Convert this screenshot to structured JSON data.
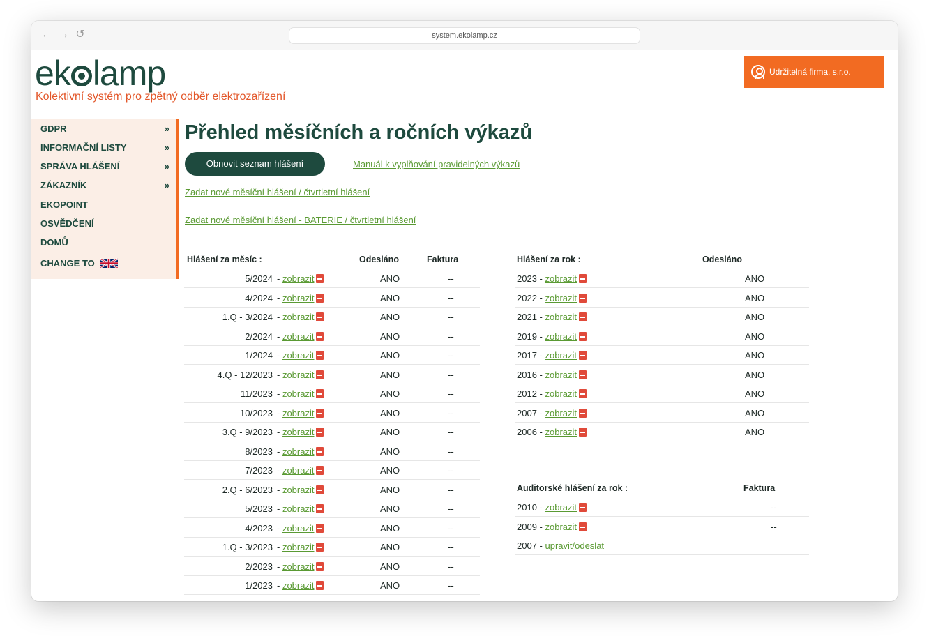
{
  "browser": {
    "url": "system.ekolamp.cz",
    "back_glyph": "←",
    "forward_glyph": "→",
    "reload_glyph": "↺"
  },
  "header": {
    "logo_pre": "ek",
    "logo_post": "lamp",
    "tagline": "Kolektivní systém pro zpětný odběr elektrozařízení",
    "user_label": "Udržitelná firma, s.r.o."
  },
  "sidebar": {
    "items": [
      {
        "label": "GDPR",
        "arrow": "»"
      },
      {
        "label": "INFORMAČNÍ LISTY",
        "arrow": "»"
      },
      {
        "label": "SPRÁVA HLÁŠENÍ",
        "arrow": "»"
      },
      {
        "label": "ZÁKAZNÍK",
        "arrow": "»"
      },
      {
        "label": "EKOPOINT",
        "arrow": ""
      },
      {
        "label": "OSVĚDČENÍ",
        "arrow": ""
      },
      {
        "label": "DOMŮ",
        "arrow": ""
      },
      {
        "label": "CHANGE TO",
        "arrow": ""
      }
    ]
  },
  "main": {
    "title": "Přehled měsíčních a ročních výkazů",
    "refresh_button": "Obnovit seznam hlášení",
    "manual_link": "Manuál k vyplňování pravidelných výkazů",
    "new_monthly_link": "Zadat nové měsíční hlášení / čtvrtletní hlášení",
    "new_battery_link": "Zadat nové měsíční hlášení - BATERIE / čtvrtletní hlášení"
  },
  "monthly": {
    "headers": {
      "period": "Hlášení za měsíc :",
      "sent": "Odesláno",
      "invoice": "Faktura"
    },
    "link_label": "zobrazit",
    "rows": [
      {
        "period": "5/2024",
        "sent": "ANO",
        "invoice": "--"
      },
      {
        "period": "4/2024",
        "sent": "ANO",
        "invoice": "--"
      },
      {
        "period": "1.Q - 3/2024",
        "sent": "ANO",
        "invoice": "--"
      },
      {
        "period": "2/2024",
        "sent": "ANO",
        "invoice": "--"
      },
      {
        "period": "1/2024",
        "sent": "ANO",
        "invoice": "--"
      },
      {
        "period": "4.Q - 12/2023",
        "sent": "ANO",
        "invoice": "--"
      },
      {
        "period": "11/2023",
        "sent": "ANO",
        "invoice": "--"
      },
      {
        "period": "10/2023",
        "sent": "ANO",
        "invoice": "--"
      },
      {
        "period": "3.Q - 9/2023",
        "sent": "ANO",
        "invoice": "--"
      },
      {
        "period": "8/2023",
        "sent": "ANO",
        "invoice": "--"
      },
      {
        "period": "7/2023",
        "sent": "ANO",
        "invoice": "--"
      },
      {
        "period": "2.Q - 6/2023",
        "sent": "ANO",
        "invoice": "--"
      },
      {
        "period": "5/2023",
        "sent": "ANO",
        "invoice": "--"
      },
      {
        "period": "4/2023",
        "sent": "ANO",
        "invoice": "--"
      },
      {
        "period": "1.Q - 3/2023",
        "sent": "ANO",
        "invoice": "--"
      },
      {
        "period": "2/2023",
        "sent": "ANO",
        "invoice": "--"
      },
      {
        "period": "1/2023",
        "sent": "ANO",
        "invoice": "--"
      }
    ]
  },
  "yearly": {
    "headers": {
      "period": "Hlášení za rok :",
      "sent": "Odesláno"
    },
    "link_label": "zobrazit",
    "rows": [
      {
        "year": "2023",
        "sent": "ANO"
      },
      {
        "year": "2022",
        "sent": "ANO"
      },
      {
        "year": "2021",
        "sent": "ANO"
      },
      {
        "year": "2019",
        "sent": "ANO"
      },
      {
        "year": "2017",
        "sent": "ANO"
      },
      {
        "year": "2016",
        "sent": "ANO"
      },
      {
        "year": "2012",
        "sent": "ANO"
      },
      {
        "year": "2007",
        "sent": "ANO"
      },
      {
        "year": "2006",
        "sent": "ANO"
      }
    ]
  },
  "audit": {
    "headers": {
      "period": "Auditorské hlášení za rok :",
      "invoice": "Faktura"
    },
    "rows": [
      {
        "year": "2010",
        "link": "zobrazit",
        "pdf": true,
        "invoice": "--"
      },
      {
        "year": "2009",
        "link": "zobrazit",
        "pdf": true,
        "invoice": "--"
      },
      {
        "year": "2007",
        "link": "upravit/odeslat",
        "pdf": false,
        "invoice": ""
      }
    ]
  },
  "colors": {
    "brand_green": "#1e4a3e",
    "accent_orange": "#f26b22",
    "link_green": "#5a9a33",
    "sidebar_bg": "#fbeee6",
    "pdf_red": "#e04a3a"
  }
}
